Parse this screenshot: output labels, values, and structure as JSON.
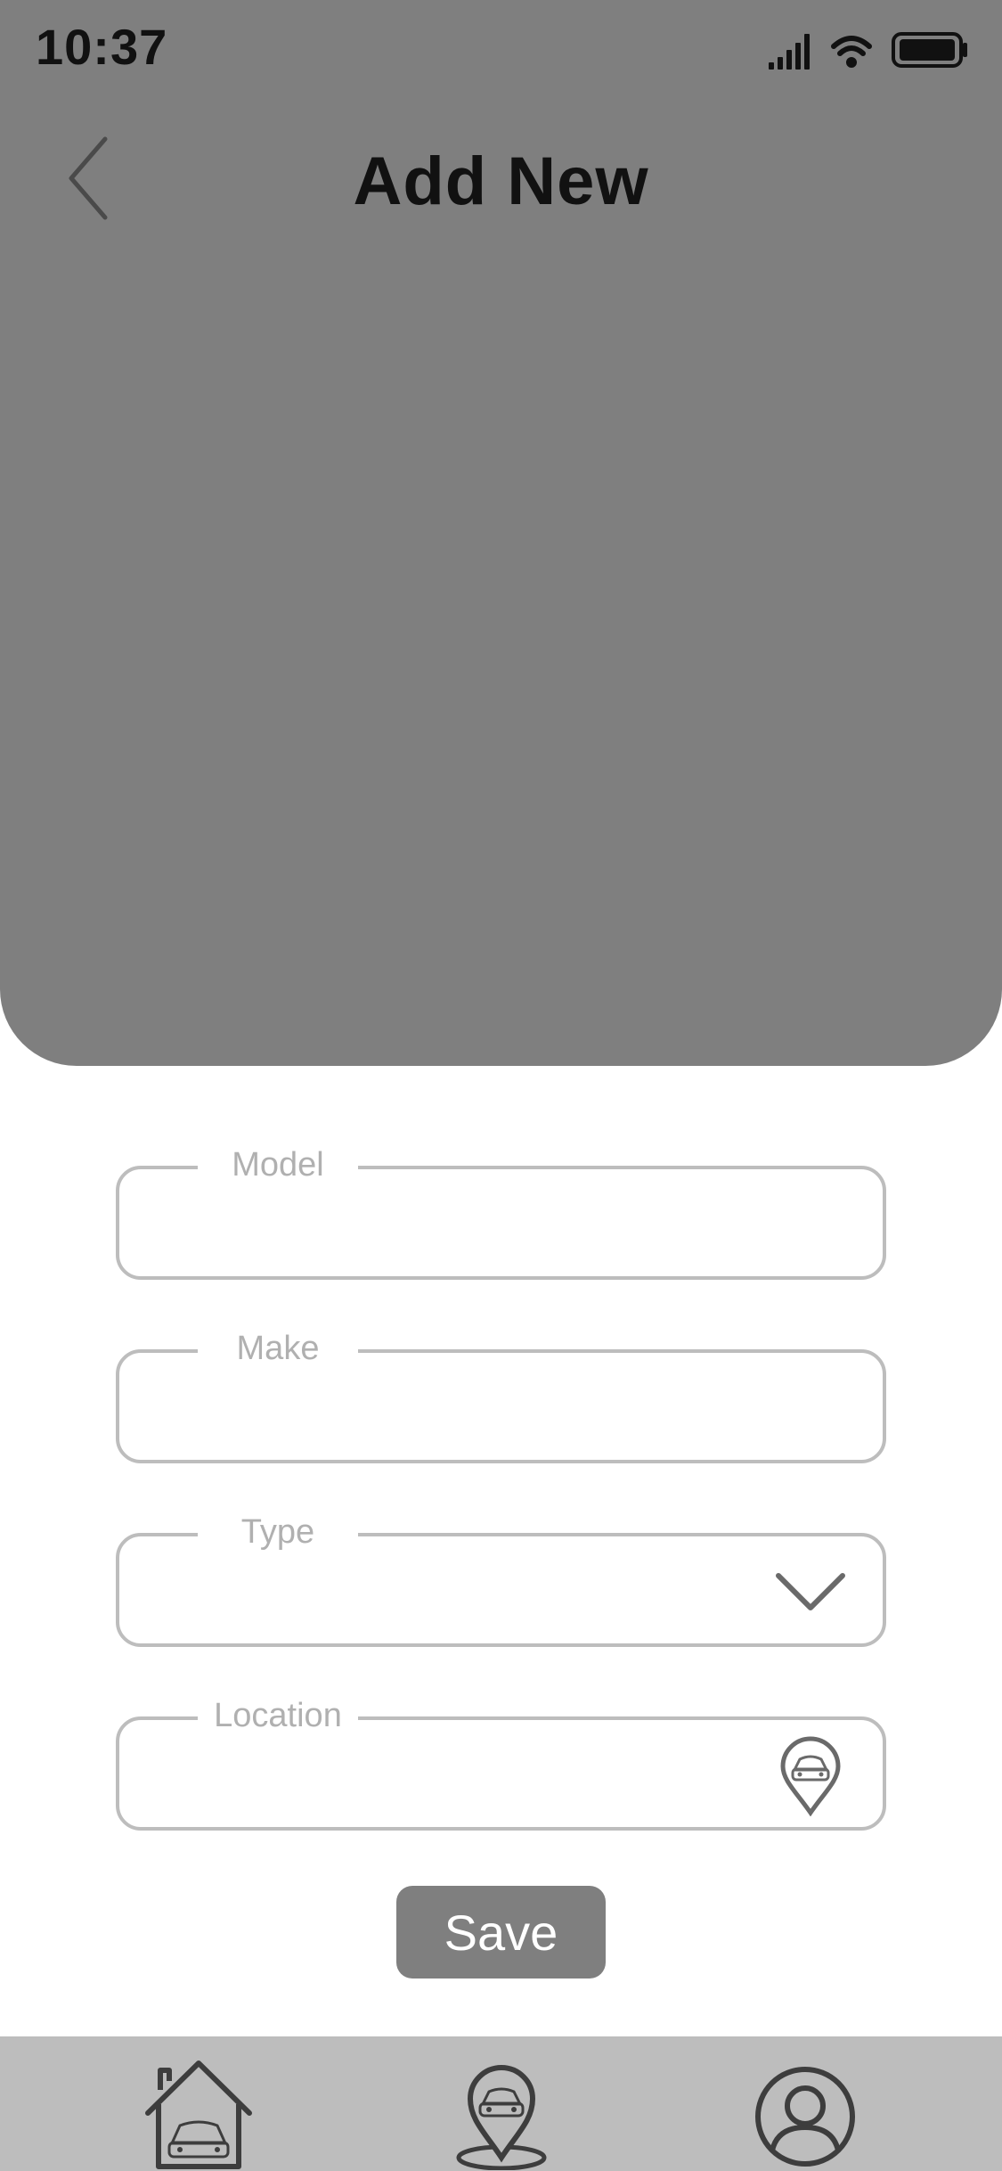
{
  "status_bar": {
    "time": "10:37",
    "icons": [
      "signal-icon",
      "wifi-icon",
      "battery-icon"
    ]
  },
  "header": {
    "title": "Add New",
    "back_icon": "chevron-left-icon"
  },
  "form": {
    "fields": [
      {
        "label": "Model",
        "value": "",
        "icon": ""
      },
      {
        "label": "Make",
        "value": "",
        "icon": ""
      },
      {
        "label": "Type",
        "value": "",
        "icon": "chevron-down-icon"
      },
      {
        "label": "Location",
        "value": "",
        "icon": "car-location-pin-icon"
      }
    ],
    "save_label": "Save"
  },
  "bottom_nav": {
    "items": [
      {
        "name": "home",
        "icon": "garage-home-icon"
      },
      {
        "name": "map",
        "icon": "car-location-icon"
      },
      {
        "name": "profile",
        "icon": "user-profile-icon"
      }
    ]
  },
  "colors": {
    "header_bg": "#7f7f7f",
    "field_border": "#bdbdbd",
    "label_text": "#b0b0b0",
    "nav_bg": "#bdbdbd",
    "button_bg": "#7f7f7f",
    "button_text": "#ffffff"
  }
}
